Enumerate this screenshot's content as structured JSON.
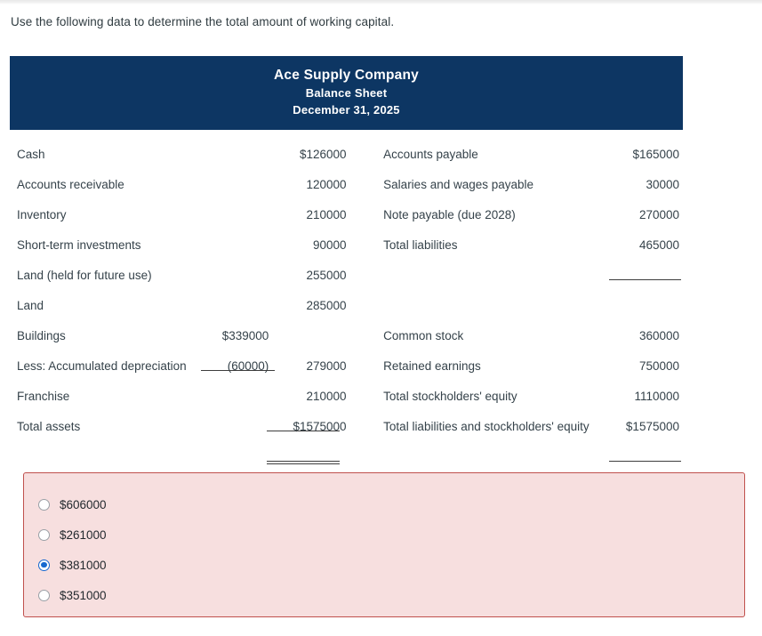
{
  "prompt": "Use the following data to determine the total amount of working capital.",
  "statement": {
    "company": "Ace Supply Company",
    "report": "Balance Sheet",
    "date": "December 31, 2025",
    "header_bg": "#0d3663",
    "assets": [
      {
        "label": "Cash",
        "sub": "",
        "value": "$126000"
      },
      {
        "label": "Accounts receivable",
        "sub": "",
        "value": "120000"
      },
      {
        "label": "Inventory",
        "sub": "",
        "value": "210000"
      },
      {
        "label": "Short-term investments",
        "sub": "",
        "value": "90000"
      },
      {
        "label": "Land (held for future use)",
        "sub": "",
        "value": "255000"
      },
      {
        "label": "Land",
        "sub": "",
        "value": "285000"
      },
      {
        "label": "Buildings",
        "sub": "$339000",
        "value": ""
      },
      {
        "label": "Less: Accumulated depreciation",
        "sub": "(60000)",
        "value": "279000"
      },
      {
        "label": "Franchise",
        "sub": "",
        "value": "210000"
      },
      {
        "label": "Total assets",
        "sub": "",
        "value": "$1575000"
      }
    ],
    "liabilities_equity": [
      {
        "label": "Accounts payable",
        "value": "$165000"
      },
      {
        "label": "Salaries and wages payable",
        "value": "30000"
      },
      {
        "label": "Note payable (due 2028)",
        "value": "270000"
      },
      {
        "label": "Total liabilities",
        "value": "465000"
      },
      {
        "label": "",
        "value": ""
      },
      {
        "label": "",
        "value": ""
      },
      {
        "label": "Common stock",
        "value": "360000"
      },
      {
        "label": "Retained earnings",
        "value": "750000"
      },
      {
        "label": "Total stockholders' equity",
        "value": "1110000"
      },
      {
        "label": "Total liabilities and stockholders' equity",
        "value": "$1575000"
      }
    ]
  },
  "answers": {
    "selected_index": 2,
    "box_bg": "#f7dfdf",
    "box_border": "#c0504d",
    "selected_color": "#1668cf",
    "options": [
      {
        "label": "$606000"
      },
      {
        "label": "$261000"
      },
      {
        "label": "$381000"
      },
      {
        "label": "$351000"
      }
    ]
  }
}
